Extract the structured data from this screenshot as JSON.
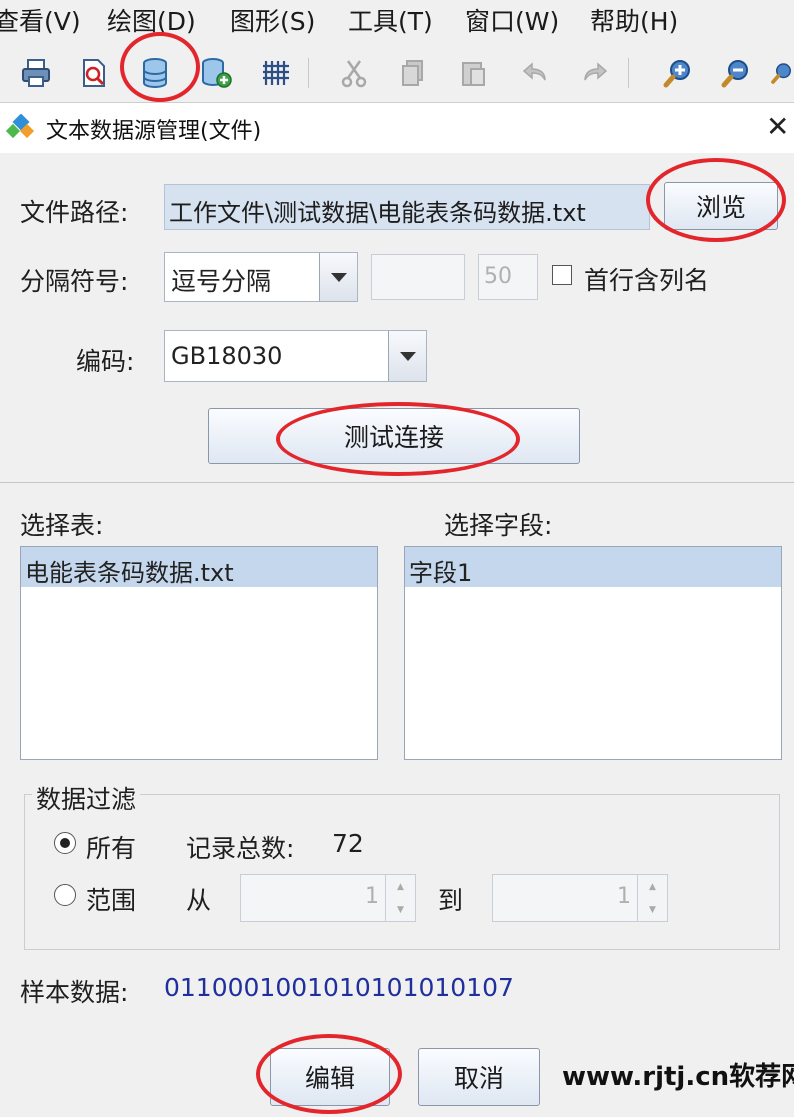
{
  "menu": {
    "items": [
      "查看(V)",
      "绘图(D)",
      "图形(S)",
      "工具(T)",
      "窗口(W)",
      "帮助(H)"
    ]
  },
  "toolbar": {
    "icons": [
      "print-icon",
      "print-preview-icon",
      "database-icon",
      "database-add-icon",
      "grid-icon",
      "cut-icon",
      "copy-icon",
      "paste-icon",
      "undo-icon",
      "redo-icon",
      "zoom-in-icon",
      "zoom-out-icon",
      "zoom-icon"
    ]
  },
  "dialog": {
    "title": "文本数据源管理(文件)",
    "close_glyph": "✕",
    "file_path_label": "文件路径:",
    "file_path_value": "工作文件\\测试数据\\电能表条码数据.txt",
    "browse_label": "浏览",
    "delimiter_label": "分隔符号:",
    "delimiter_value": "逗号分隔",
    "width_value": "",
    "width_number": "50",
    "first_row_label": "首行含列名",
    "first_row_checked": false,
    "encoding_label": "编码:",
    "encoding_value": "GB18030",
    "test_connection_label": "测试连接",
    "select_table_label": "选择表:",
    "tables": [
      "电能表条码数据.txt"
    ],
    "select_field_label": "选择字段:",
    "fields": [
      "字段1"
    ],
    "filter_group_label": "数据过滤",
    "filter_all_label": "所有",
    "filter_all_selected": true,
    "record_count_label": "记录总数:",
    "record_count_value": "72",
    "filter_range_label": "范围",
    "from_label": "从",
    "from_value": "1",
    "to_label": "到",
    "to_value": "1",
    "sample_label": "样本数据:",
    "sample_value": "0110001001010101010107",
    "edit_label": "编辑",
    "cancel_label": "取消"
  },
  "watermark": "www.rjtj.cn软荐网",
  "colors": {
    "highlight_circle": "#e3262c",
    "sample_text": "#1f2f9c",
    "selection": "#c5d7ec"
  }
}
